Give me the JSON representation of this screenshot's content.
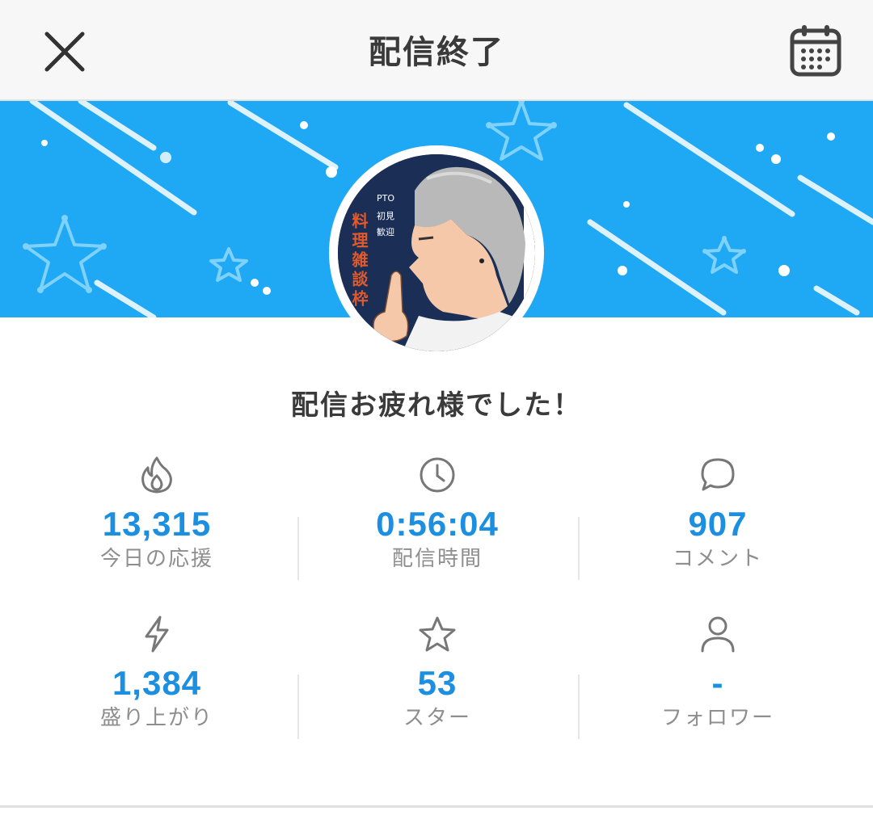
{
  "header": {
    "title": "配信終了",
    "close_icon": "close-icon",
    "calendar_icon": "calendar-icon"
  },
  "banner": {
    "background_color": "#1fa8f3"
  },
  "avatar": {
    "thumbnail_text": {
      "vertical_title": "料理雑談枠",
      "tag_1": "PTO",
      "tag_2": "初見",
      "tag_3": "歓迎"
    }
  },
  "greeting": "配信お疲れ様でした！",
  "accent_color": "#1c8fe0",
  "stats": [
    {
      "icon": "flame-icon",
      "value": "13,315",
      "label": "今日の応援"
    },
    {
      "icon": "clock-icon",
      "value": "0:56:04",
      "label": "配信時間"
    },
    {
      "icon": "comment-icon",
      "value": "907",
      "label": "コメント"
    },
    {
      "icon": "lightning-icon",
      "value": "1,384",
      "label": "盛り上がり"
    },
    {
      "icon": "star-icon",
      "value": "53",
      "label": "スター"
    },
    {
      "icon": "user-icon",
      "value": "-",
      "label": "フォロワー"
    }
  ]
}
